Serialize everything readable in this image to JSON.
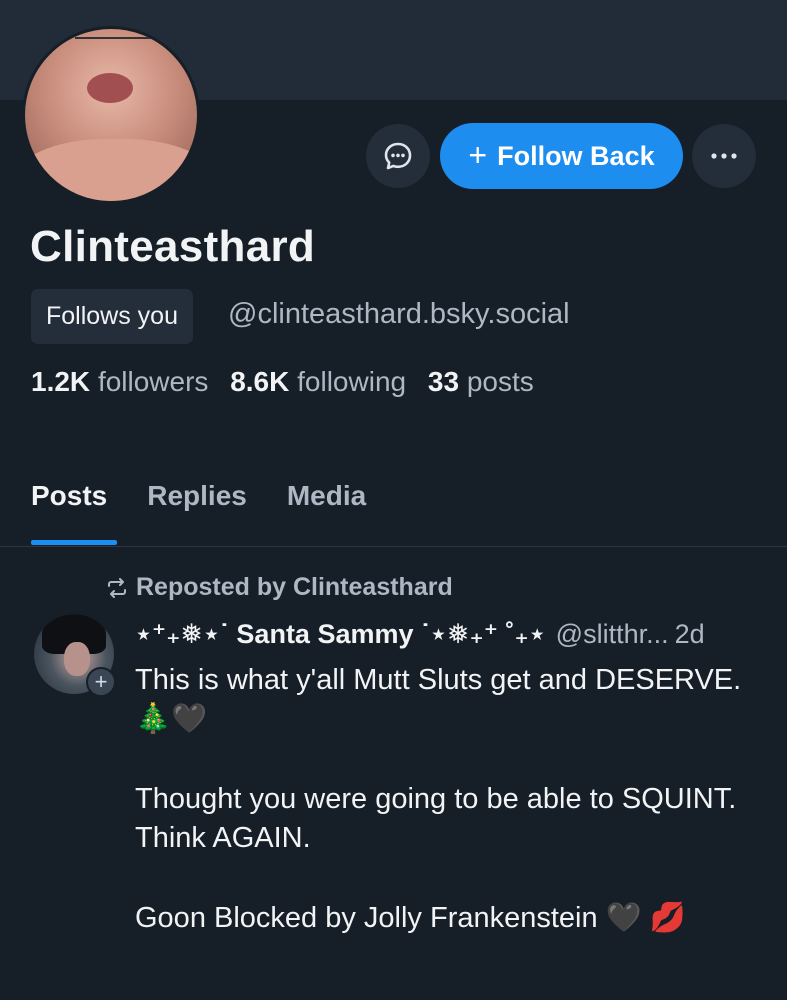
{
  "profile": {
    "display_name": "Clinteasthard",
    "follows_you": "Follows you",
    "handle": "@clinteasthard.bsky.social",
    "followers_count": "1.2K",
    "followers_label": "followers",
    "following_count": "8.6K",
    "following_label": "following",
    "posts_count": "33",
    "posts_label": "posts"
  },
  "actions": {
    "follow_back_label": "Follow Back",
    "message_icon": "message-icon",
    "more_icon": "more-icon"
  },
  "tabs": [
    {
      "label": "Posts",
      "active": true
    },
    {
      "label": "Replies",
      "active": false
    },
    {
      "label": "Media",
      "active": false
    }
  ],
  "feed": {
    "repost_label": "Reposted by Clinteasthard",
    "post": {
      "author": "⋆⁺₊❅⋆˙ Santa Sammy ˙⋆❅₊⁺ ˚₊⋆",
      "handle": "@slitthr...",
      "time": "2d",
      "lines": [
        "This is what y'all Mutt Sluts get and DESERVE. 🎄🖤",
        "Thought you were going to be able to SQUINT. Think AGAIN.",
        "Goon Blocked by Jolly Frankenstein 🖤 💋"
      ]
    }
  },
  "colors": {
    "background": "#161e27",
    "banner": "#222c38",
    "accent": "#1d8df0",
    "muted_text": "#aeb8c4"
  }
}
